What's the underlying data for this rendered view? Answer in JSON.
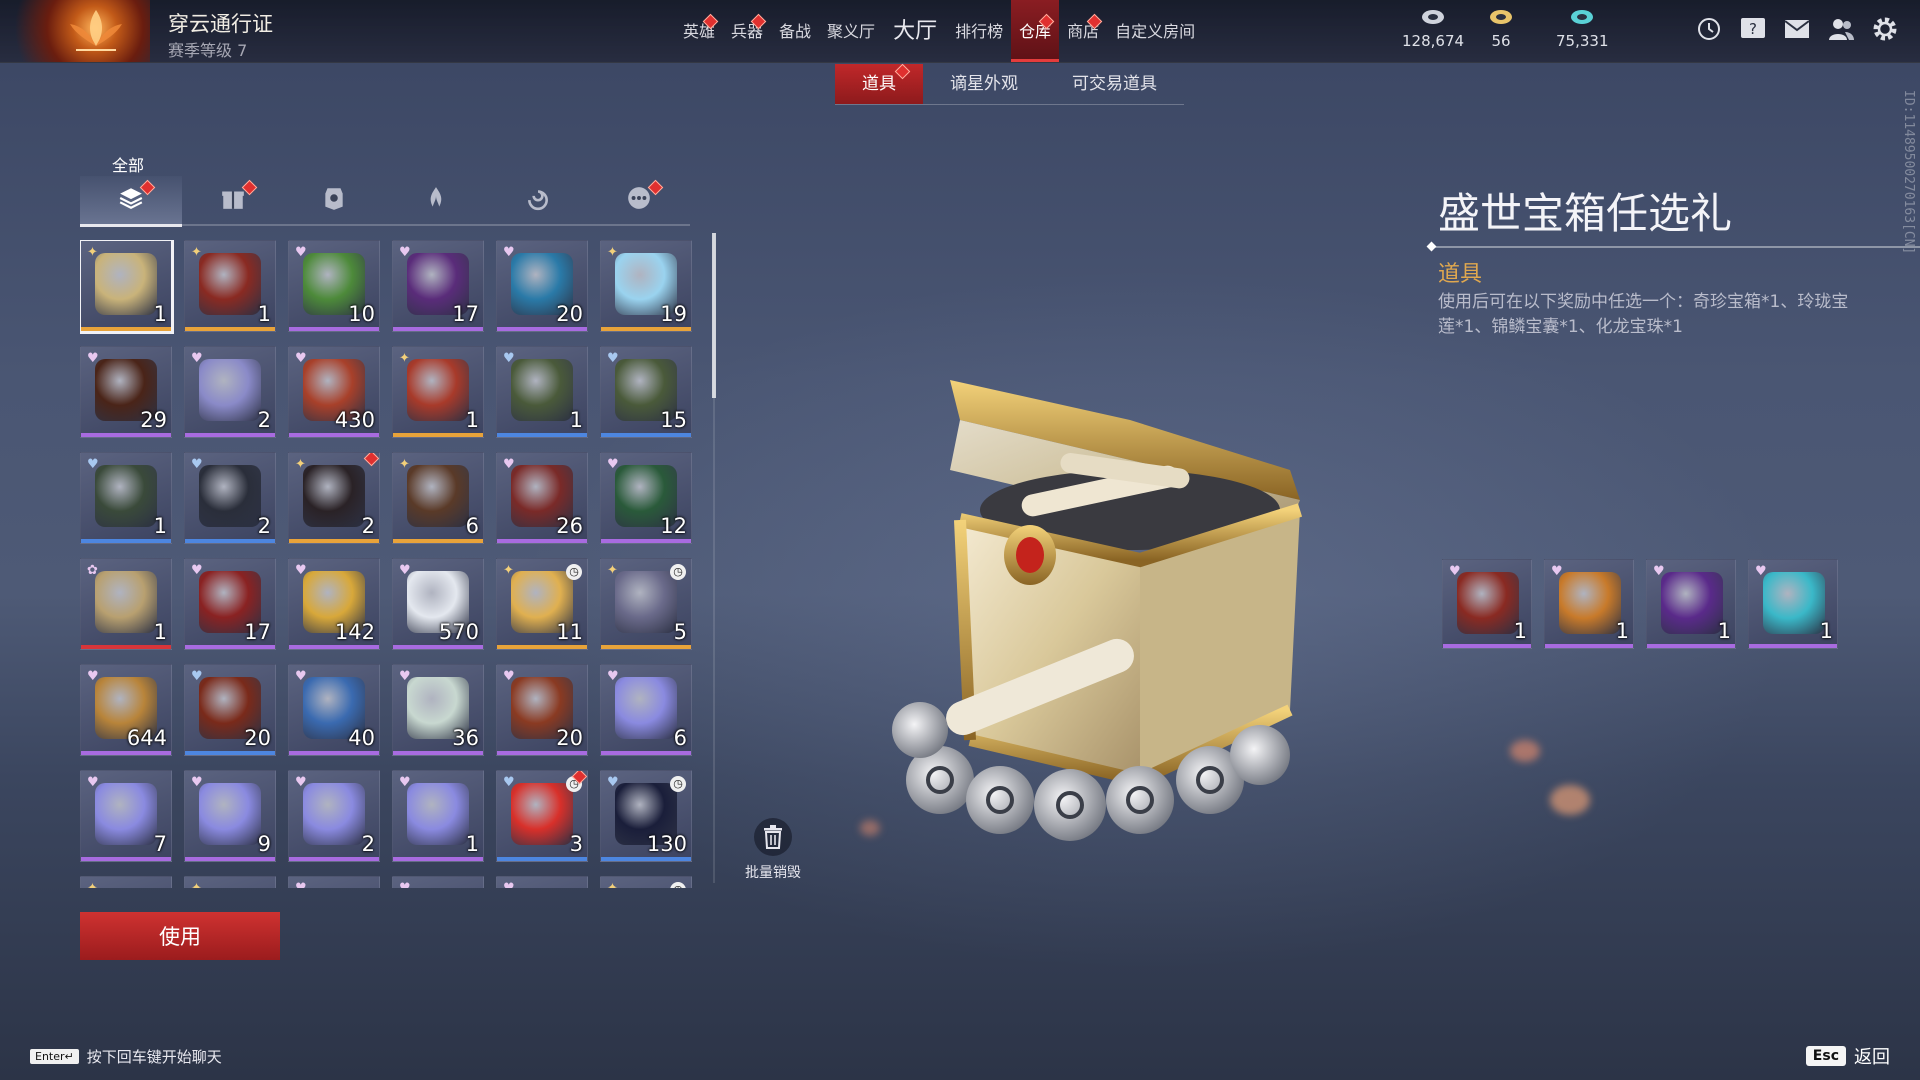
{
  "pass": {
    "title": "穿云通行证",
    "level": "赛季等级 7"
  },
  "nav": [
    {
      "label": "英雄",
      "dot": true,
      "big": false,
      "active": false
    },
    {
      "label": "兵器",
      "dot": true,
      "big": false,
      "active": false
    },
    {
      "label": "备战",
      "dot": false,
      "big": false,
      "active": false
    },
    {
      "label": "聚义厅",
      "dot": false,
      "big": false,
      "active": false
    },
    {
      "label": "大厅",
      "dot": false,
      "big": true,
      "active": false
    },
    {
      "label": "排行榜",
      "dot": false,
      "big": false,
      "active": false
    },
    {
      "label": "仓库",
      "dot": true,
      "big": false,
      "active": true
    },
    {
      "label": "商店",
      "dot": true,
      "big": false,
      "active": false
    },
    {
      "label": "自定义房间",
      "dot": false,
      "big": false,
      "active": false
    }
  ],
  "currencies": [
    {
      "icon": "coin-icon",
      "value": "128,674",
      "color": "#cfd3dc"
    },
    {
      "icon": "ticket-icon",
      "value": "56",
      "color": "#e8c46a"
    },
    {
      "icon": "feather-icon",
      "value": "75,331",
      "color": "#5ad1d6"
    }
  ],
  "top_icons": [
    "clock-icon",
    "help-icon",
    "mail-icon",
    "friends-icon",
    "settings-icon"
  ],
  "subtabs": [
    {
      "label": "道具",
      "active": true,
      "dot": true
    },
    {
      "label": "谪星外观",
      "active": false,
      "dot": false
    },
    {
      "label": "可交易道具",
      "active": false,
      "dot": false
    }
  ],
  "vertical_id": "ID:11489500270163[CN]",
  "categories": {
    "selected_label": "全部",
    "tabs": [
      {
        "icon": "layers-icon",
        "dot": true,
        "active": true
      },
      {
        "icon": "gift-icon",
        "dot": true,
        "active": false
      },
      {
        "icon": "badge-icon",
        "dot": false,
        "active": false
      },
      {
        "icon": "flame-icon",
        "dot": false,
        "active": false
      },
      {
        "icon": "swirl-icon",
        "dot": false,
        "active": false
      },
      {
        "icon": "more-icon",
        "dot": true,
        "active": false
      }
    ]
  },
  "rarity_colors": {
    "orange": "#e8a33a",
    "purple": "#a86be0",
    "blue": "#4d86e0",
    "red": "#d8353a"
  },
  "items": [
    {
      "qty": "1",
      "rarity": "orange",
      "color": "#c9b37a",
      "selected": true
    },
    {
      "qty": "1",
      "rarity": "orange",
      "color": "#8a2a22"
    },
    {
      "qty": "10",
      "rarity": "purple",
      "color": "#4d8a3a"
    },
    {
      "qty": "17",
      "rarity": "purple",
      "color": "#5a2c7a"
    },
    {
      "qty": "20",
      "rarity": "purple",
      "color": "#2a7aa8"
    },
    {
      "qty": "19",
      "rarity": "orange",
      "color": "#9ad3ef"
    },
    {
      "qty": "29",
      "rarity": "purple",
      "color": "#4a2418"
    },
    {
      "qty": "2",
      "rarity": "purple",
      "color": "#8a8ac8"
    },
    {
      "qty": "430",
      "rarity": "purple",
      "color": "#a8402a"
    },
    {
      "qty": "1",
      "rarity": "orange",
      "color": "#a83a2a"
    },
    {
      "qty": "1",
      "rarity": "blue",
      "color": "#4a5a3a"
    },
    {
      "qty": "15",
      "rarity": "blue",
      "color": "#4a5a3a"
    },
    {
      "qty": "1",
      "rarity": "blue",
      "color": "#3a4a3a"
    },
    {
      "qty": "2",
      "rarity": "blue",
      "color": "#2a2e3a"
    },
    {
      "qty": "2",
      "rarity": "orange",
      "color": "#2a2226",
      "dot": true
    },
    {
      "qty": "6",
      "rarity": "orange",
      "color": "#5a3a28"
    },
    {
      "qty": "26",
      "rarity": "purple",
      "color": "#7a2a28"
    },
    {
      "qty": "12",
      "rarity": "purple",
      "color": "#2a5a3a"
    },
    {
      "qty": "1",
      "rarity": "red",
      "color": "#b8a070"
    },
    {
      "qty": "17",
      "rarity": "purple",
      "color": "#8a2222"
    },
    {
      "qty": "142",
      "rarity": "purple",
      "color": "#d8a83a"
    },
    {
      "qty": "570",
      "rarity": "purple",
      "color": "#e4e8ef"
    },
    {
      "qty": "11",
      "rarity": "orange",
      "color": "#e0b050",
      "clock": true
    },
    {
      "qty": "5",
      "rarity": "orange",
      "color": "#6a6a8a",
      "clock": true
    },
    {
      "qty": "644",
      "rarity": "purple",
      "color": "#b8843a"
    },
    {
      "qty": "20",
      "rarity": "blue",
      "color": "#7a2a1a"
    },
    {
      "qty": "40",
      "rarity": "purple",
      "color": "#3a6ab0"
    },
    {
      "qty": "36",
      "rarity": "purple",
      "color": "#c8d8d0"
    },
    {
      "qty": "20",
      "rarity": "purple",
      "color": "#8a3a22"
    },
    {
      "qty": "6",
      "rarity": "purple",
      "color": "#8a8ae0"
    },
    {
      "qty": "7",
      "rarity": "purple",
      "color": "#8a8ae0"
    },
    {
      "qty": "9",
      "rarity": "purple",
      "color": "#8a8ae0"
    },
    {
      "qty": "2",
      "rarity": "purple",
      "color": "#8a8ae0"
    },
    {
      "qty": "1",
      "rarity": "purple",
      "color": "#8a8ae0"
    },
    {
      "qty": "3",
      "rarity": "blue",
      "color": "#d8302a",
      "clock": true,
      "dot": true
    },
    {
      "qty": "130",
      "rarity": "blue",
      "color": "#1a1e3a",
      "clock": true
    },
    {
      "qty": "",
      "rarity": "orange",
      "color": "#6a5a40"
    },
    {
      "qty": "",
      "rarity": "orange",
      "color": "#5a4a3a"
    },
    {
      "qty": "",
      "rarity": "purple",
      "color": "#5a4a6a"
    },
    {
      "qty": "",
      "rarity": "purple",
      "color": "#5a4a3a"
    },
    {
      "qty": "",
      "rarity": "purple",
      "color": "#d8d0c0"
    },
    {
      "qty": "",
      "rarity": "orange",
      "color": "#8a2a22",
      "clock": true
    }
  ],
  "bulk_destroy": {
    "label": "批量销毁"
  },
  "use_button": {
    "label": "使用"
  },
  "detail": {
    "title": "盛世宝箱任选礼",
    "type": "道具",
    "description": "使用后可在以下奖励中任选一个：奇珍宝箱*1、玲珑宝莲*1、锦鳞宝囊*1、化龙宝珠*1"
  },
  "rewards": [
    {
      "qty": "1",
      "rarity": "purple",
      "color": "#8a2a22"
    },
    {
      "qty": "1",
      "rarity": "purple",
      "color": "#c87a2a"
    },
    {
      "qty": "1",
      "rarity": "purple",
      "color": "#5a2a8a"
    },
    {
      "qty": "1",
      "rarity": "purple",
      "color": "#3ab8c8"
    }
  ],
  "footer": {
    "enter_key": "Enter↵",
    "chat_hint": "按下回车键开始聊天",
    "esc_key": "Esc",
    "back_label": "返回"
  }
}
